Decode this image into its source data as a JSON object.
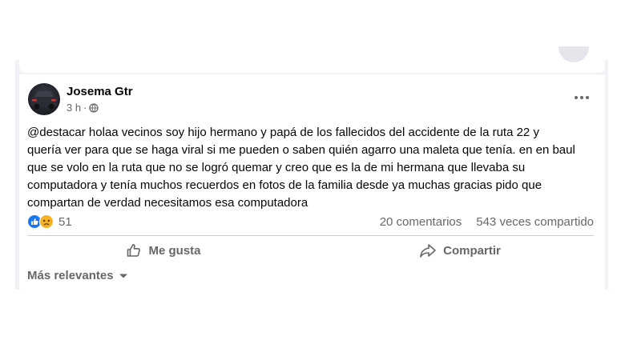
{
  "post": {
    "author": "Josema Gtr",
    "time": "3 h",
    "body": "@destacar holaa vecinos soy hijo hermano y papá de los fallecidos del accidente de la ruta 22 y\nquería ver para que se haga viral si me pueden o saben quién agarro una maleta que tenía. en en baul\nque se volo en la ruta que no se logró quemar y creo que es la de mi hermana que llevaba su\ncomputadora y tenía muchos recuerdos en fotos de la familia desde ya muchas gracias pido que\ncompartan de verdad necesitamos esa computadora",
    "reaction_count": "51",
    "comments": "20 comentarios",
    "shares": "543 veces compartido"
  },
  "actions": {
    "like": "Me gusta",
    "share": "Compartir"
  },
  "comments_sort": "Más relevantes",
  "icons": [
    "audience-globe-icon",
    "more-options-icon",
    "like-reaction-icon",
    "sad-reaction-icon",
    "thumbs-up-icon",
    "share-arrow-icon",
    "caret-down-icon"
  ],
  "colors": {
    "like_blue": "#1877f2",
    "reaction_yellow": "#f7b125",
    "secondary_text": "#65676b"
  }
}
